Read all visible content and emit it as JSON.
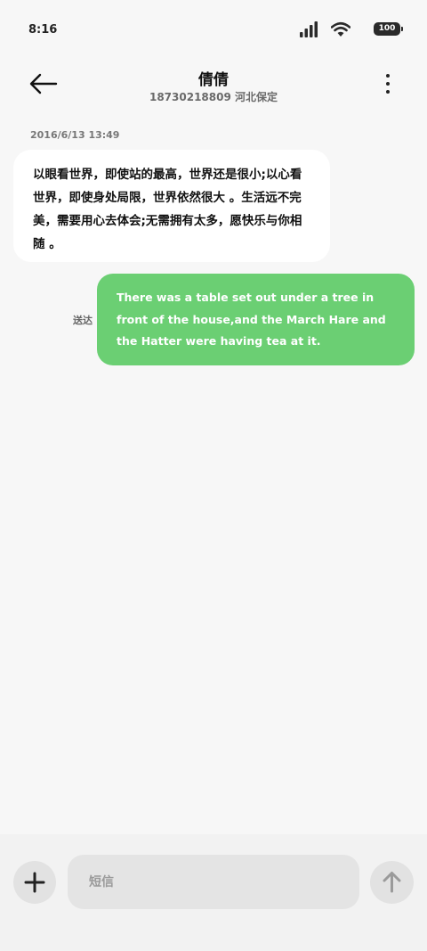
{
  "status_bar": {
    "time": "8:16",
    "battery": "100",
    "icons": [
      "signal-icon",
      "wifi-icon",
      "battery-icon"
    ]
  },
  "header": {
    "back_icon": "arrow-left-icon",
    "title": "倩倩",
    "subtitle": "18730218809 河北保定",
    "more_icon": "more-vertical-icon"
  },
  "conversation": {
    "timestamp": "2016/6/13 13:49",
    "received_message": "以眼看世界，即使站的最高，世界还是很小;以心看世界，即使身处局限，世界依然很大 。生活远不完美，需要用心去体会;无需拥有太多，愿快乐与你相随 。",
    "sent_status": "送达",
    "sent_message": "There was a table set out under a tree in front of the house,and the March Hare and the Hatter were having tea at it."
  },
  "composer": {
    "add_icon": "plus-icon",
    "input_placeholder": "短信",
    "input_value": "",
    "send_icon": "arrow-up-icon"
  },
  "colors": {
    "background": "#f7f7f7",
    "sent_bubble": "#6bcf73",
    "received_bubble": "#ffffff",
    "composer_bg": "#f2f2f2"
  }
}
